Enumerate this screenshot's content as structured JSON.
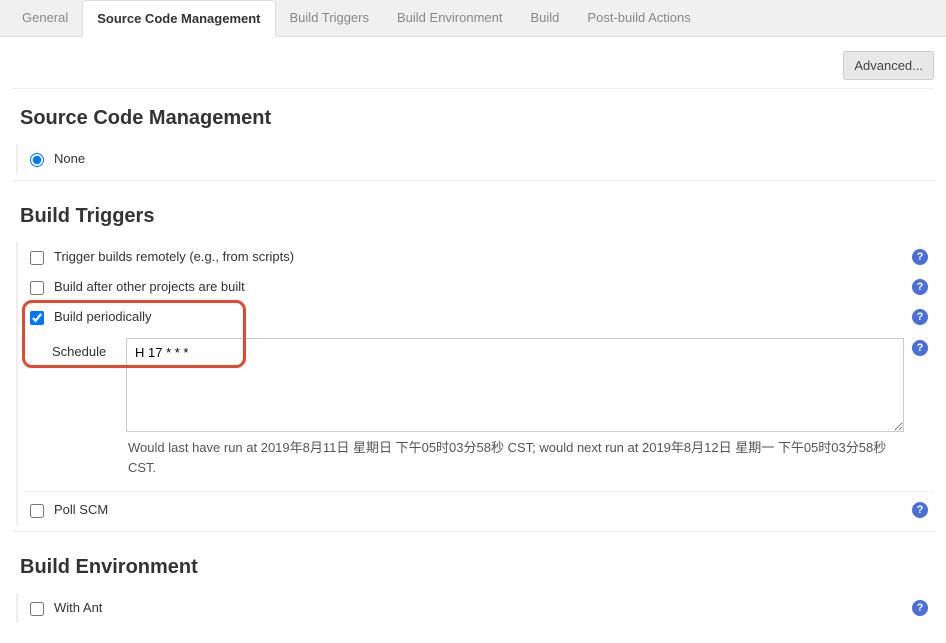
{
  "tabs": [
    {
      "label": "General"
    },
    {
      "label": "Source Code Management",
      "active": true
    },
    {
      "label": "Build Triggers"
    },
    {
      "label": "Build Environment"
    },
    {
      "label": "Build"
    },
    {
      "label": "Post-build Actions"
    }
  ],
  "advanced_label": "Advanced...",
  "scm": {
    "title": "Source Code Management",
    "none_label": "None"
  },
  "triggers": {
    "title": "Build Triggers",
    "remote_label": "Trigger builds remotely (e.g., from scripts)",
    "after_label": "Build after other projects are built",
    "periodic_label": "Build periodically",
    "schedule_label": "Schedule",
    "schedule_value": "H 17 * * *",
    "schedule_info": "Would last have run at 2019年8月11日 星期日 下午05时03分58秒 CST; would next run at 2019年8月12日 星期一 下午05时03分58秒 CST.",
    "pollscm_label": "Poll SCM"
  },
  "env": {
    "title": "Build Environment",
    "withant_label": "With Ant"
  },
  "help_glyph": "?"
}
